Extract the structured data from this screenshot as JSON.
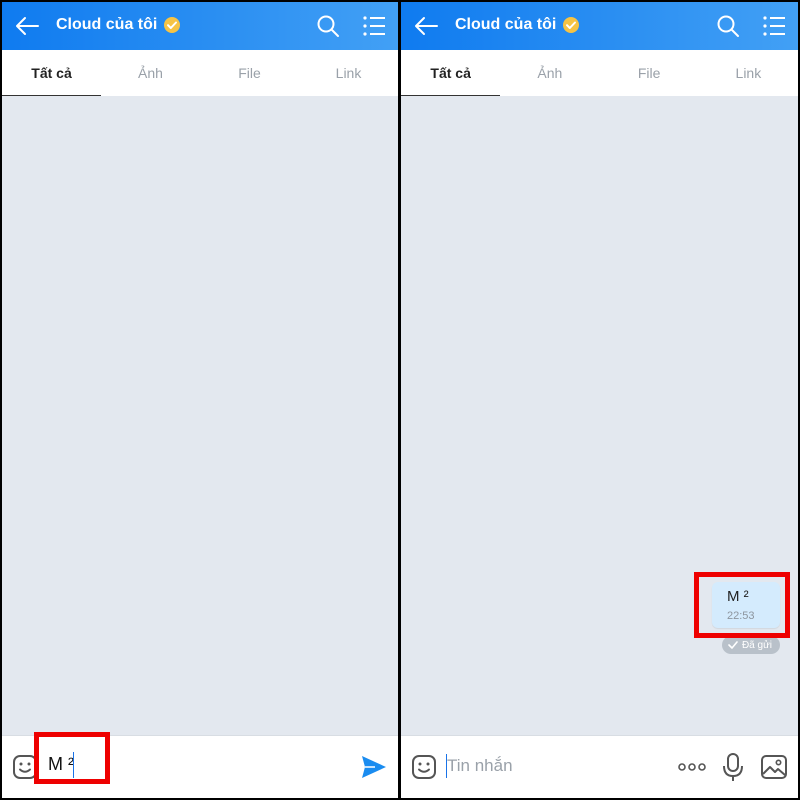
{
  "header": {
    "title": "Cloud của tôi",
    "verified_icon": "verified-check-icon"
  },
  "tabs": [
    {
      "label": "Tất cả",
      "active": true
    },
    {
      "label": "Ảnh",
      "active": false
    },
    {
      "label": "File",
      "active": false
    },
    {
      "label": "Link",
      "active": false
    }
  ],
  "left_panel": {
    "input_value": "M ²"
  },
  "right_panel": {
    "message": {
      "text": "M ²",
      "time": "22:53",
      "status": "Đã gửi"
    },
    "input_placeholder": "Tin nhắn"
  },
  "colors": {
    "header_start": "#0f7bf0",
    "header_end": "#42a0f5",
    "chat_bg": "#e3e8ef",
    "bubble_bg": "#d4ebfd",
    "send_blue": "#1a8cf0",
    "highlight_red": "#ee0000"
  },
  "icons": [
    "back-arrow-icon",
    "search-icon",
    "menu-list-icon",
    "emoji-icon",
    "send-icon",
    "more-dots-icon",
    "mic-icon",
    "image-icon",
    "check-icon"
  ]
}
